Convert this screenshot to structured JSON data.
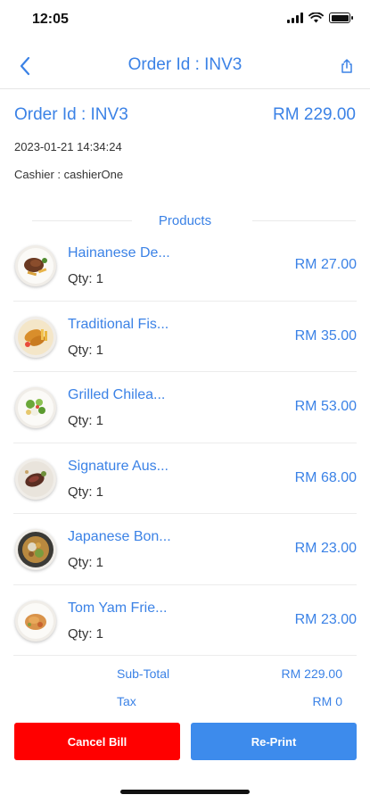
{
  "status_bar": {
    "time": "12:05"
  },
  "nav": {
    "title": "Order Id : INV3"
  },
  "order": {
    "id_label": "Order Id : INV3",
    "total": "RM 229.00",
    "datetime": "2023-01-21 14:34:24",
    "cashier": "Cashier : cashierOne"
  },
  "products": {
    "header": "Products",
    "items": [
      {
        "name": "Hainanese De...",
        "qty": "Qty: 1",
        "price": "RM 27.00",
        "image_icon": "dish-steak-icon"
      },
      {
        "name": "Traditional Fis...",
        "qty": "Qty: 1",
        "price": "RM 35.00",
        "image_icon": "dish-fish-chips-icon"
      },
      {
        "name": "Grilled Chilea...",
        "qty": "Qty: 1",
        "price": "RM 53.00",
        "image_icon": "dish-salad-icon"
      },
      {
        "name": "Signature Aus...",
        "qty": "Qty: 1",
        "price": "RM 68.00",
        "image_icon": "dish-beef-icon"
      },
      {
        "name": "Japanese Bon...",
        "qty": "Qty: 1",
        "price": "RM 23.00",
        "image_icon": "dish-rice-bowl-icon"
      },
      {
        "name": "Tom Yam Frie...",
        "qty": "Qty: 1",
        "price": "RM 23.00",
        "image_icon": "dish-fried-rice-icon"
      }
    ]
  },
  "summary": {
    "subtotal_label": "Sub-Total",
    "subtotal_value": "RM 229.00",
    "tax_label": "Tax",
    "tax_value": "RM 0"
  },
  "actions": {
    "cancel_label": "Cancel Bill",
    "reprint_label": "Re-Print"
  },
  "colors": {
    "accent": "#3b82e6",
    "cancel": "#ff0000",
    "reprint": "#3d8bec"
  }
}
